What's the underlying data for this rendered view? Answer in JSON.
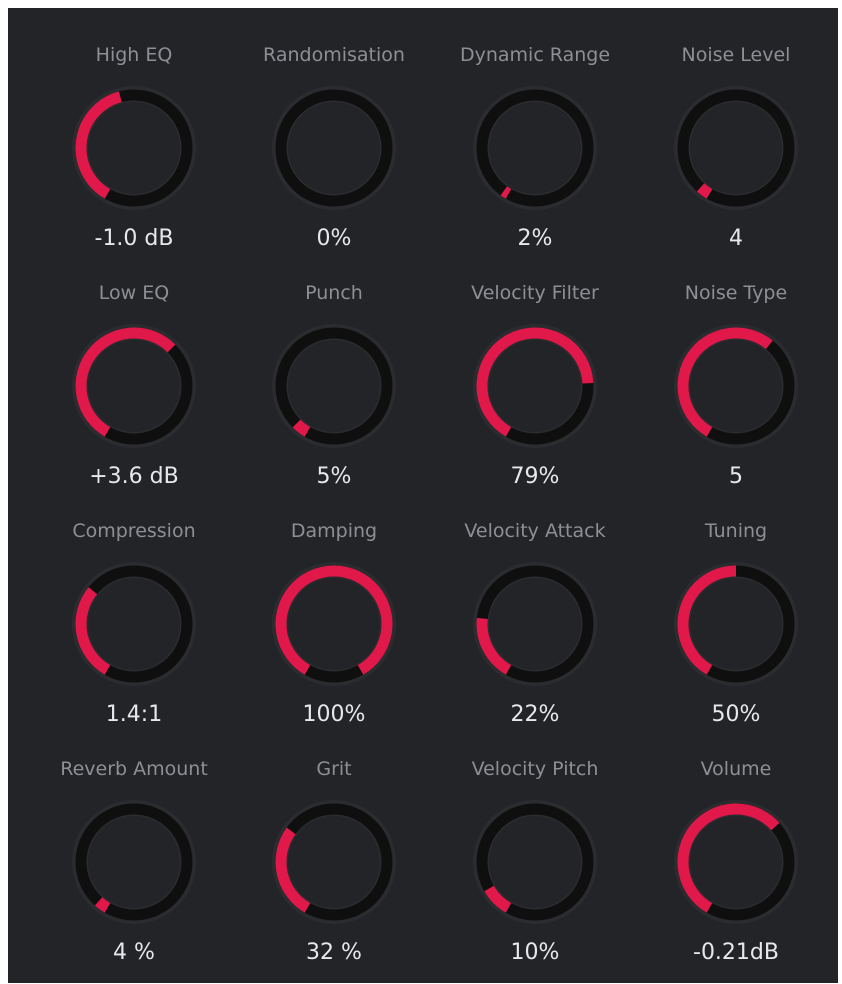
{
  "colors": {
    "background": "#232427",
    "accent": "#e0194a",
    "track_outer": "#2b2c2f",
    "ring": "#0f0f10",
    "label": "#8e8f94",
    "value": "#e8e8ea"
  },
  "knobs": [
    {
      "label": "High EQ",
      "value": "-1.0 dB",
      "level": 0.45
    },
    {
      "label": "Randomisation",
      "value": "0%",
      "level": 0
    },
    {
      "label": "Dynamic Range",
      "value": "2%",
      "level": 0.02
    },
    {
      "label": "Noise Level",
      "value": "4",
      "level": 0.04
    },
    {
      "label": "Low EQ",
      "value": "+3.6 dB",
      "level": 0.65
    },
    {
      "label": "Punch",
      "value": "5%",
      "level": 0.05
    },
    {
      "label": "Velocity Filter",
      "value": "79%",
      "level": 0.79
    },
    {
      "label": "Noise Type",
      "value": "5",
      "level": 0.63
    },
    {
      "label": "Compression",
      "value": "1.4:1",
      "level": 0.33
    },
    {
      "label": "Damping",
      "value": "100%",
      "level": 1.0
    },
    {
      "label": "Velocity Attack",
      "value": "22%",
      "level": 0.22
    },
    {
      "label": "Tuning",
      "value": "50%",
      "level": 0.5
    },
    {
      "label": "Reverb Amount",
      "value": "4 %",
      "level": 0.04
    },
    {
      "label": "Grit",
      "value": "32 %",
      "level": 0.32
    },
    {
      "label": "Velocity Pitch",
      "value": "10%",
      "level": 0.1
    },
    {
      "label": "Volume",
      "value": "-0.21dB",
      "level": 0.66
    }
  ]
}
